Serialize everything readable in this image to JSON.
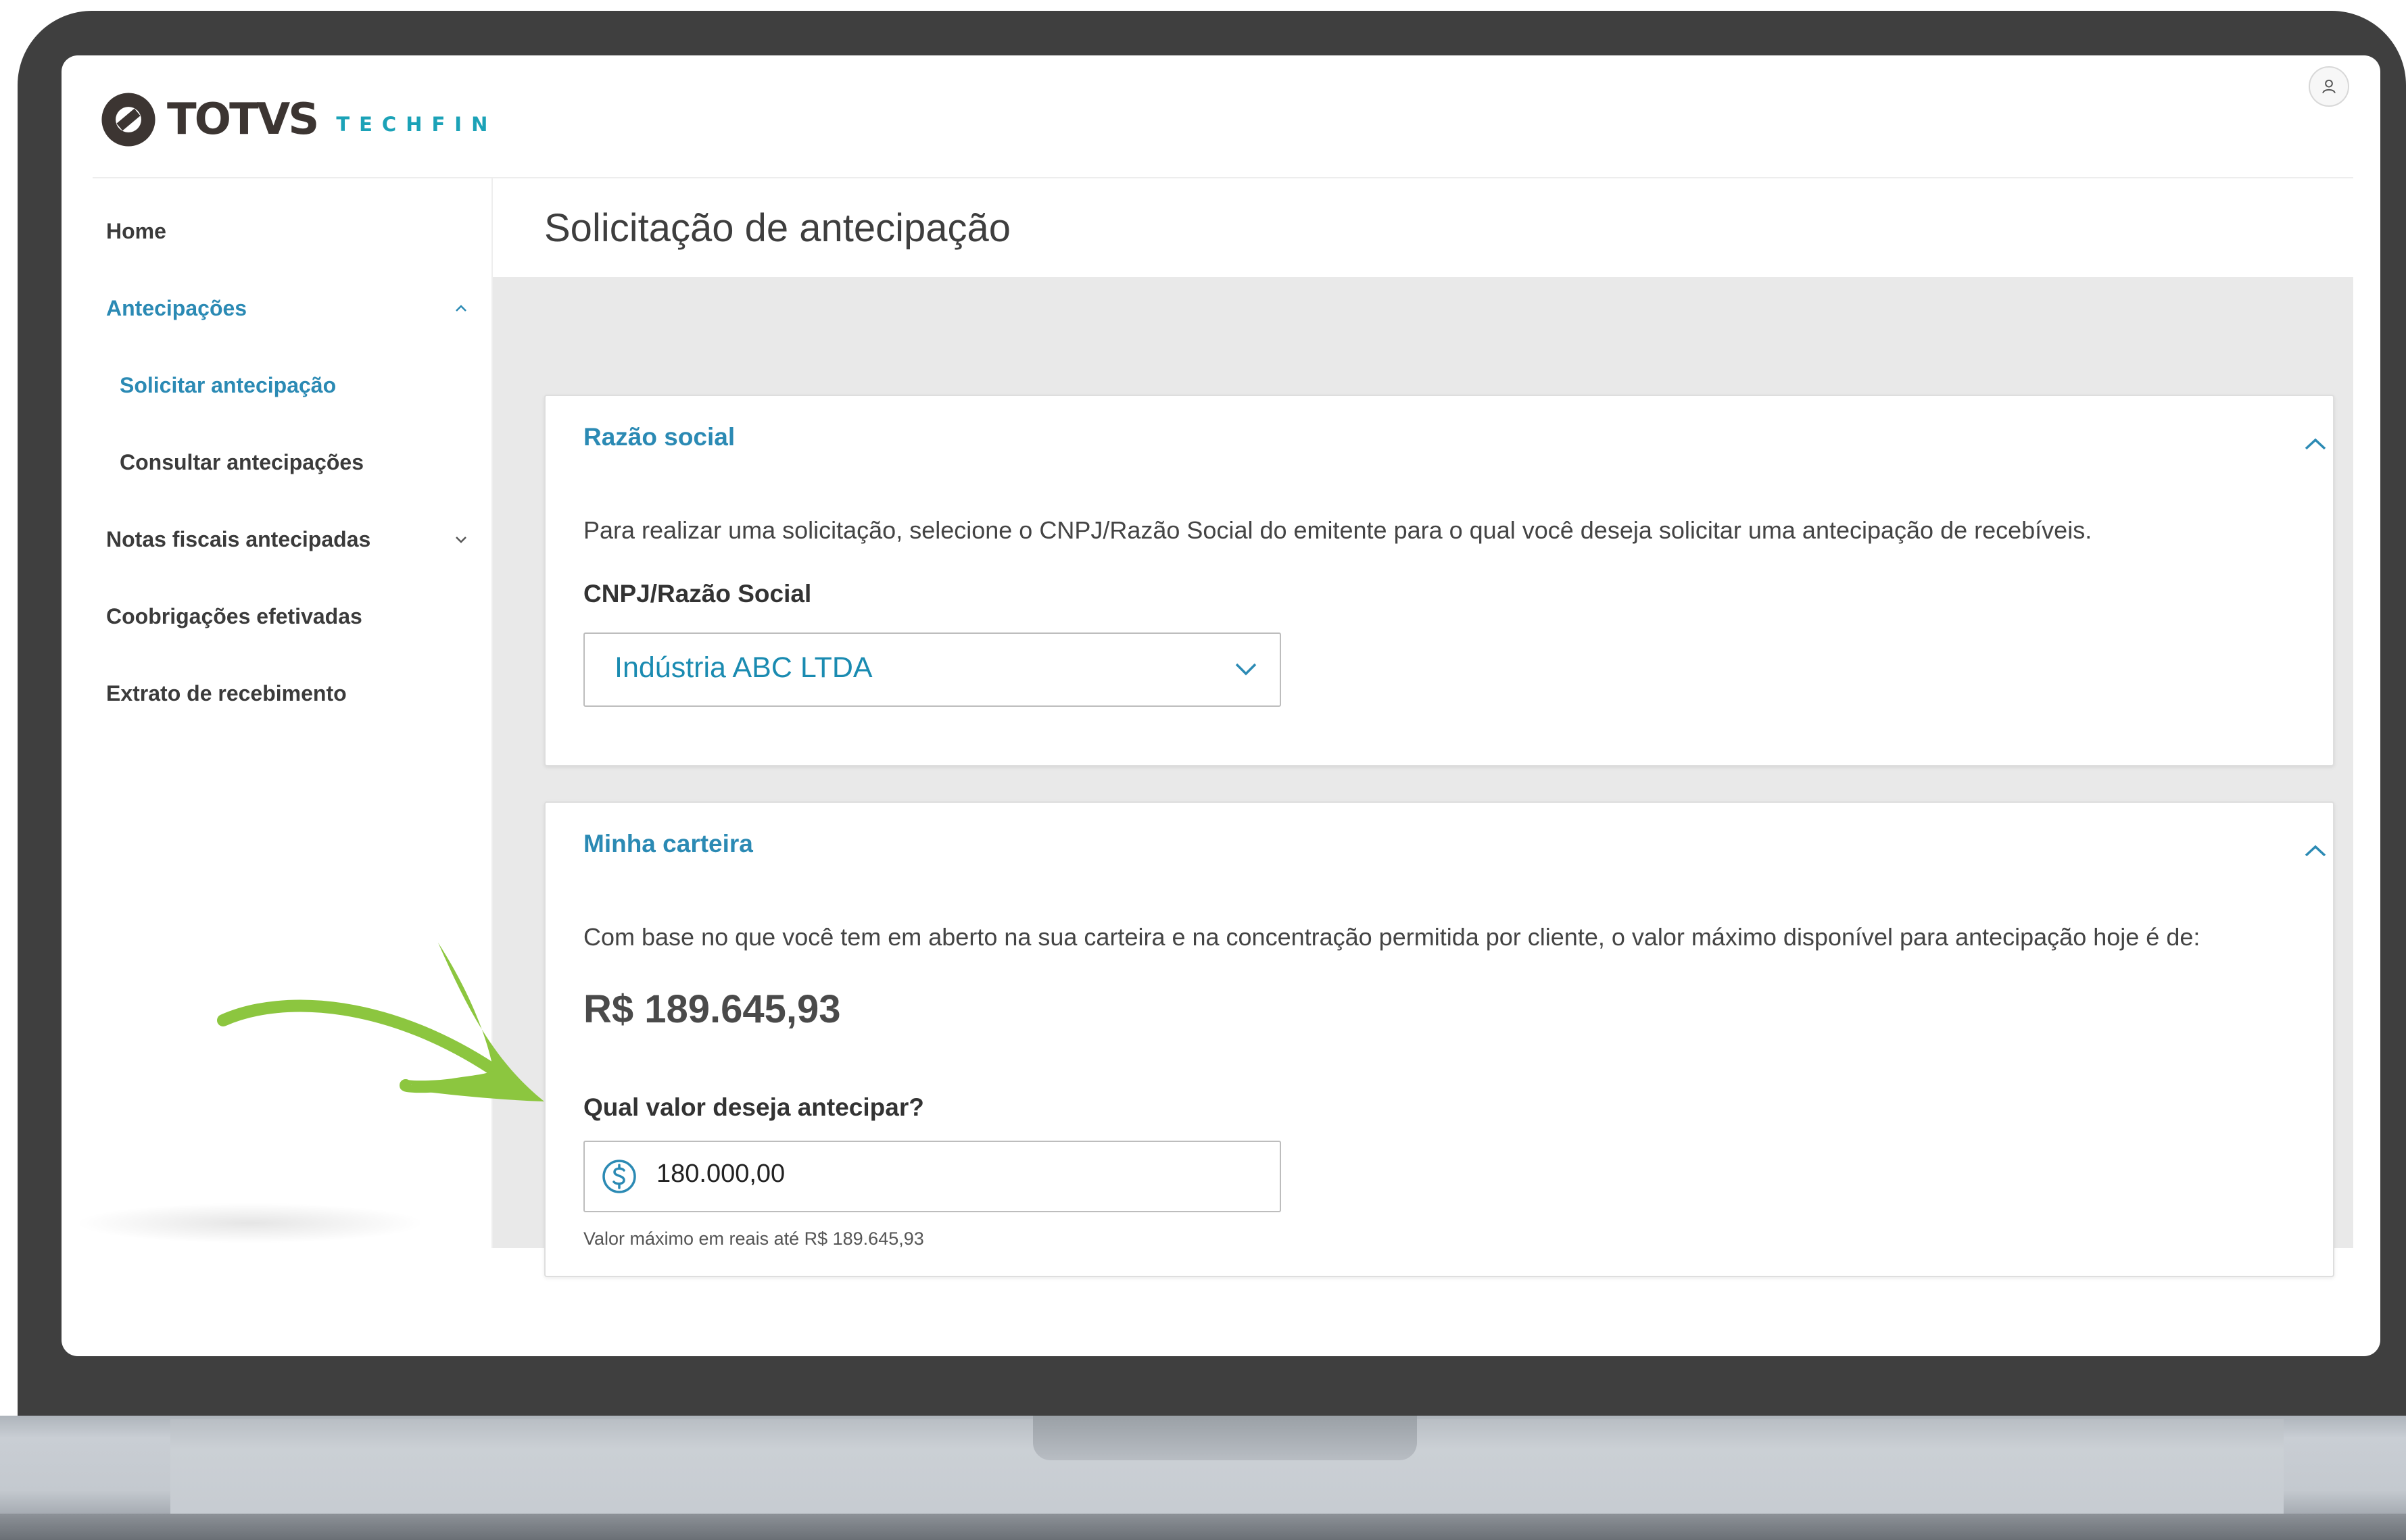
{
  "brand": {
    "name": "TOTVS",
    "sub": "TECHFIN",
    "accent_color": "#1ba2b7",
    "logo_color": "#3c3532"
  },
  "header": {
    "user_icon": "user-icon"
  },
  "sidebar": {
    "items": [
      {
        "label": "Home",
        "active": false
      },
      {
        "label": "Antecipações",
        "active": true,
        "expanded": true,
        "icon": "chevron-up-icon"
      },
      {
        "label": "Solicitar antecipação",
        "active": true,
        "sub": true
      },
      {
        "label": "Consultar antecipações",
        "active": false,
        "sub": true
      },
      {
        "label": "Notas fiscais antecipadas",
        "active": false,
        "expanded": false,
        "icon": "chevron-down-icon"
      },
      {
        "label": "Coobrigações efetivadas",
        "active": false
      },
      {
        "label": "Extrato de recebimento",
        "active": false
      }
    ]
  },
  "page": {
    "title": "Solicitação de antecipação"
  },
  "razao_social": {
    "title": "Razão social",
    "description": "Para realizar uma solicitação, selecione o CNPJ/Razão Social do emitente para o qual você deseja solicitar uma antecipação de recebíveis.",
    "field_label": "CNPJ/Razão Social",
    "selected": "Indústria ABC LTDA"
  },
  "minha_carteira": {
    "title": "Minha carteira",
    "description": "Com base no que você tem em aberto na sua carteira e na concentração permitida por cliente, o valor máximo disponível para antecipação hoje é de:",
    "max_amount": "R$ 189.645,93",
    "field_label": "Qual valor deseja antecipar?",
    "input_value": "180.000,00",
    "helper": "Valor máximo em reais até R$ 189.645,93"
  },
  "colors": {
    "primary_blue": "#2b8ab4",
    "arrow_green": "#8cc63f",
    "laptop_frame": "#3f3f3f"
  }
}
